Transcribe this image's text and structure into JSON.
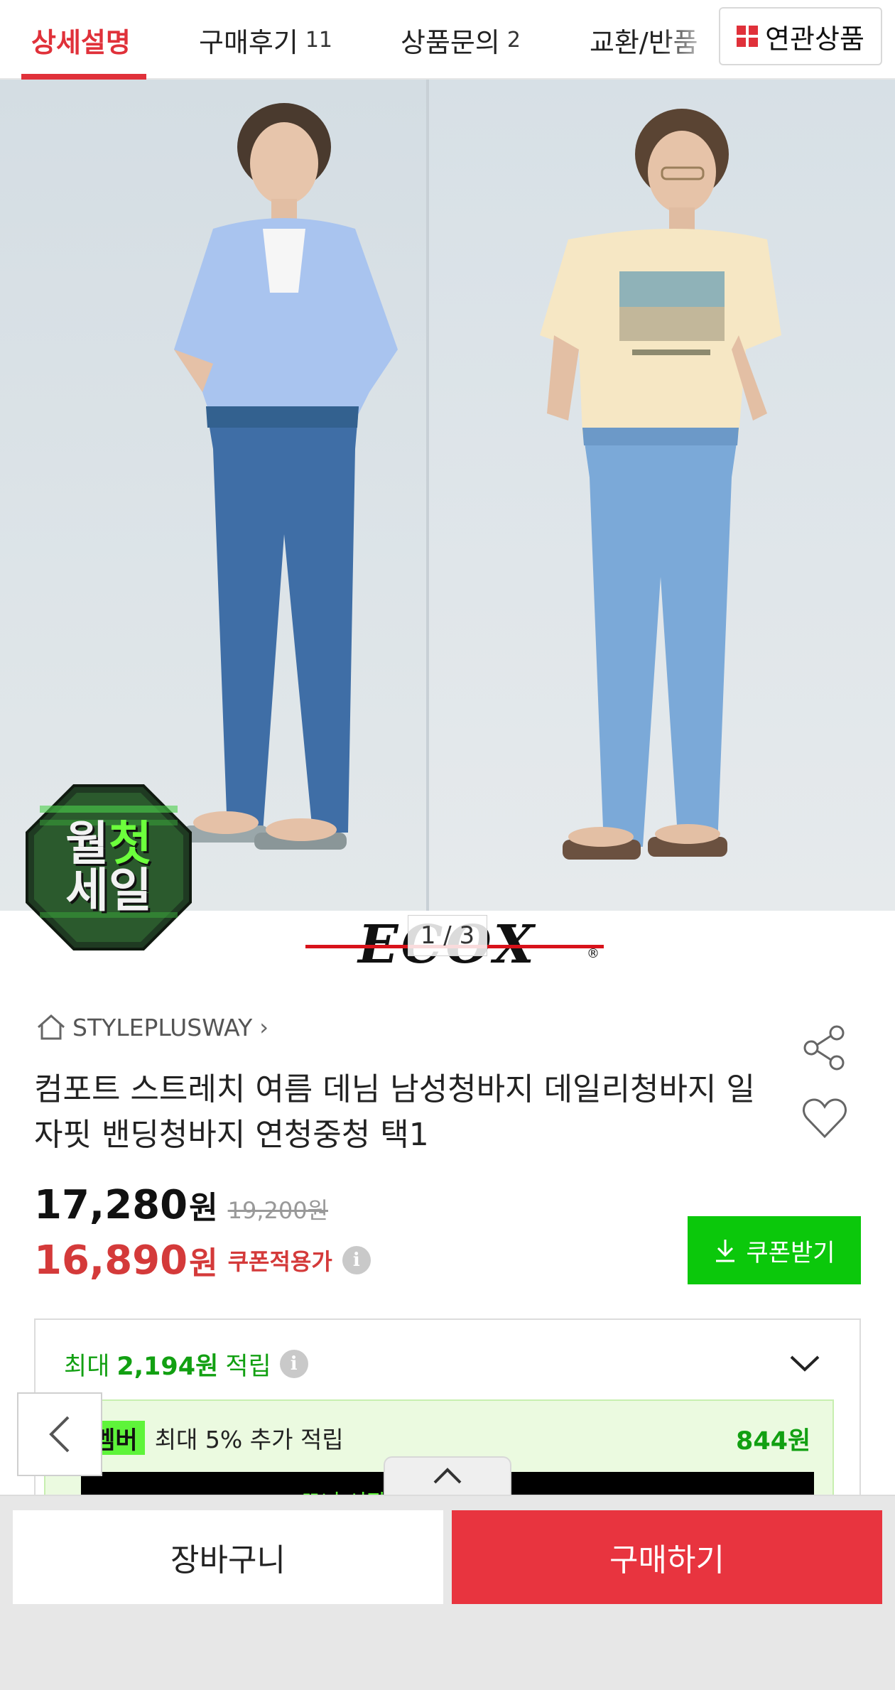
{
  "tabs": [
    {
      "label": "상세설명",
      "count": ""
    },
    {
      "label": "구매후기",
      "count": "11"
    },
    {
      "label": "상품문의",
      "count": "2"
    },
    {
      "label": "교환/반품",
      "count": ""
    }
  ],
  "related_label": "연관상품",
  "badge": {
    "line1_a": "월",
    "line1_b": "첫",
    "line2": "세일"
  },
  "brand_logo": "ECOX",
  "pager": "1 / 3",
  "store": {
    "name": "STYLEPLUSWAY",
    "chevron": "›"
  },
  "product": {
    "title": "컴포트 스트레치 여름 데님 남성청바지 데일리청바지 일자핏 밴딩청바지 연청중청 택1",
    "price": "17,280",
    "price_unit": "원",
    "original_price": "19,200원",
    "coupon_price": "16,890",
    "coupon_unit": "원",
    "coupon_label": "쿠폰적용가"
  },
  "coupon_button": "쿠폰받기",
  "points": {
    "prefix": "최대",
    "amount": "2,194원",
    "suffix": "적립"
  },
  "member": {
    "tag": "꼭 멤버",
    "desc": "최대 5% 추가 적립",
    "amount": "844원",
    "banner": "꼬니 시작                    받기 >"
  },
  "bottom": {
    "cart": "장바구니",
    "buy": "구매하기"
  },
  "colors": {
    "accent_red": "#e0313a",
    "buy_red": "#e8343f",
    "green": "#0bc80b"
  }
}
